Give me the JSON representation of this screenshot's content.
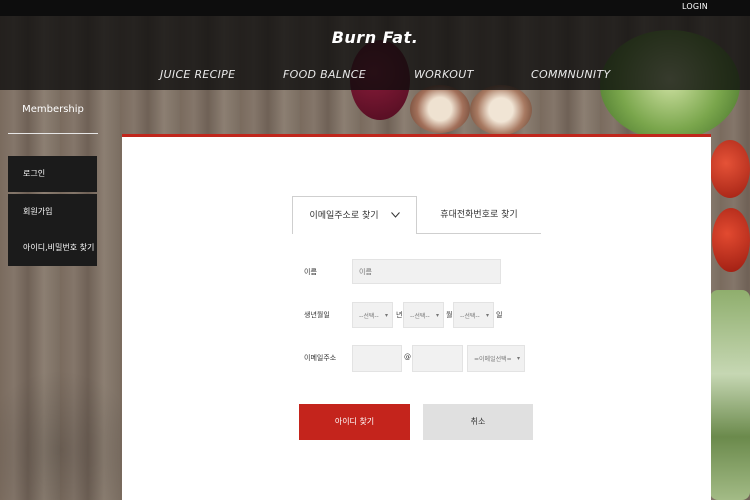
{
  "header": {
    "login_label": "LOGIN",
    "brand": "Burn Fat.",
    "nav": [
      "JUICE RECIPE",
      "FOOD BALNCE",
      "WORKOUT",
      "COMMNUNITY"
    ]
  },
  "sidebar": {
    "title": "Membership",
    "items": [
      {
        "label": "로그인"
      },
      {
        "label": "회원가입"
      },
      {
        "label": "아이디,비밀번호 찾기"
      }
    ]
  },
  "tabs": {
    "email": "이메일주소로 찾기",
    "phone": "휴대전화번호로 찾기"
  },
  "form": {
    "name_label": "이름",
    "name_placeholder": "이름",
    "birth_label": "생년월일",
    "year_select": "--선택--",
    "year_unit": "년",
    "month_select": "--선택--",
    "month_unit": "월",
    "day_select": "--선택--",
    "day_unit": "일",
    "email_label": "이메일주소",
    "at_symbol": "@",
    "email_domain_select": "=이메일선택="
  },
  "actions": {
    "find_id": "아이디 찾기",
    "cancel": "취소"
  },
  "colors": {
    "accent": "#c4241c",
    "header_bg": "#0d0d0d",
    "sidebar_button_bg": "#1b1b1b"
  }
}
